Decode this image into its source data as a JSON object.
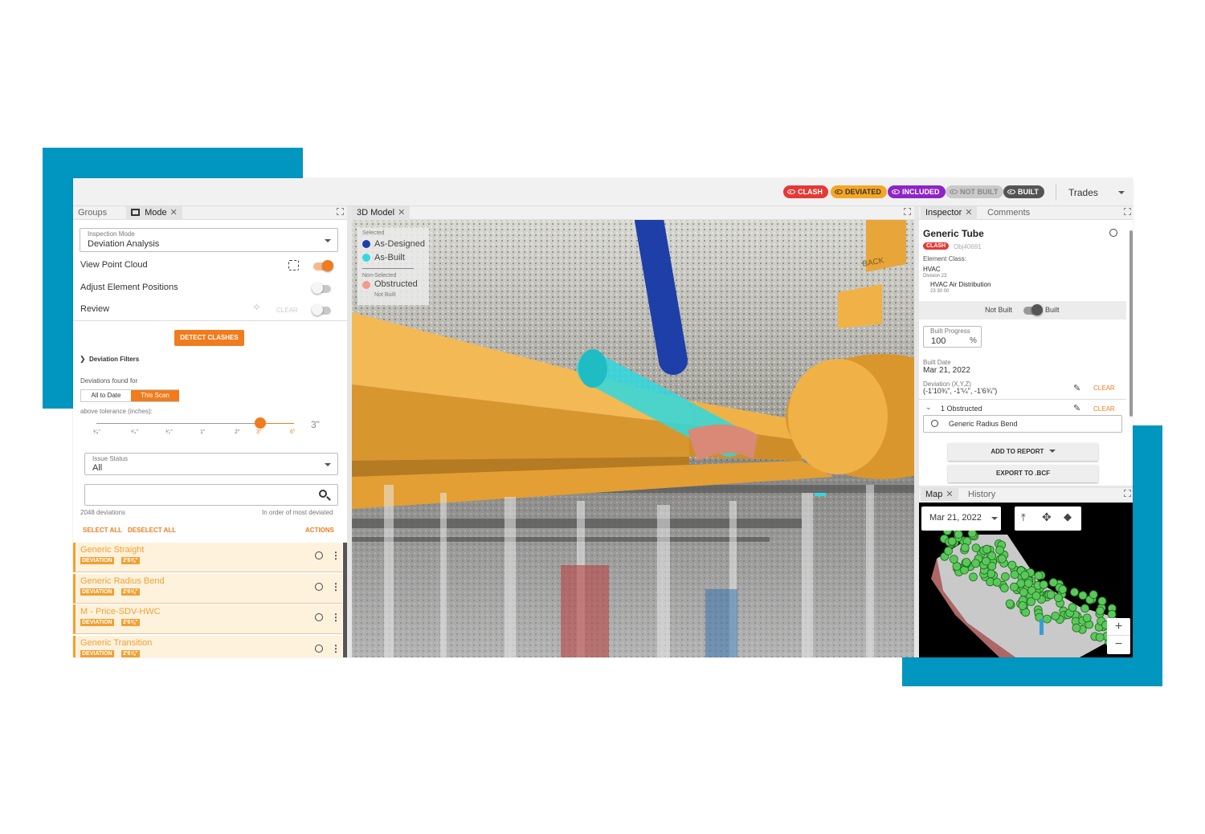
{
  "header": {
    "badges": [
      {
        "label": "CLASH",
        "color": "#e53935",
        "text_color": "#ffffff"
      },
      {
        "label": "DEVIATED",
        "color": "#f6a623",
        "text_color": "#333333"
      },
      {
        "label": "INCLUDED",
        "color": "#8e24c7",
        "text_color": "#ffffff"
      },
      {
        "label": "NOT BUILT",
        "color": "#c9c9c9",
        "text_color": "#888888"
      },
      {
        "label": "BUILT",
        "color": "#555555",
        "text_color": "#ffffff"
      }
    ],
    "trades_label": "Trades"
  },
  "left": {
    "tabs": [
      "Groups",
      "Mode"
    ],
    "inspection_mode_label": "Inspection Mode",
    "inspection_mode_value": "Deviation Analysis",
    "view_point_cloud": "View Point Cloud",
    "adjust_positions": "Adjust Element Positions",
    "review": "Review",
    "clear": "CLEAR",
    "detect_clashes": "DETECT CLASHES",
    "deviation_filters": "Deviation Filters",
    "deviations_found_for": "Deviations found for",
    "scope_options": [
      "All to Date",
      "This Scan"
    ],
    "scope_selected": "This Scan",
    "above_tolerance": "above tolerance (inches):",
    "slider_ticks": [
      "¹⁄₈\"",
      "¹⁄₄\"",
      "¹⁄₂\"",
      "1\"",
      "2\"",
      "3\"",
      "6\""
    ],
    "slider_value": "3\"",
    "issue_status_label": "Issue Status",
    "issue_status_value": "All",
    "search_placeholder": "",
    "count": "2048 deviations",
    "order": "In order of most deviated",
    "select_all": "SELECT ALL",
    "deselect_all": "DESELECT ALL",
    "actions": "ACTIONS",
    "items": [
      {
        "name": "Generic Straight",
        "tag": "DEVIATION",
        "value": "2'6⅝\""
      },
      {
        "name": "Generic Radius Bend",
        "tag": "DEVIATION",
        "value": "2'6⅝\""
      },
      {
        "name": "M - Price-SDV-HWC",
        "tag": "DEVIATION",
        "value": "2'6⅝\""
      },
      {
        "name": "Generic Transition",
        "tag": "DEVIATION",
        "value": "2'6⅝\""
      }
    ]
  },
  "viewer": {
    "tab": "3D Model",
    "legend": {
      "selected_title": "Selected",
      "as_designed": "As-Designed",
      "as_built": "As-Built",
      "non_selected_title": "Non-Selected",
      "obstructed": "Obstructed",
      "not_built": "Not Built"
    },
    "back_label": "BACK",
    "colors": {
      "as_designed": "#1e3fa8",
      "as_built": "#2fd9e0",
      "obstructed": "#f29a8c",
      "duct": "#e9a53a"
    }
  },
  "inspector": {
    "tabs": [
      "Inspector",
      "Comments"
    ],
    "title": "Generic Tube",
    "badge": "CLASH",
    "obj_id": "Obj40691",
    "element_class_label": "Element Class:",
    "element_class": "HVAC",
    "division_label": "Division 23",
    "division_value": "HVAC Air Distribution",
    "division_code": "23 30 00",
    "not_built": "Not Built",
    "built": "Built",
    "built_progress_label": "Built Progress",
    "built_progress_value": "100",
    "percent": "%",
    "built_date_label": "Built Date",
    "built_date_value": "Mar 21, 2022",
    "deviation_label": "Deviation (X,Y,Z)",
    "deviation_value": "(-1'10¾\", -1'¼\", -1'6¾\")",
    "clear": "CLEAR",
    "obstructed_count": "1 Obstructed",
    "obstructed_item": "Generic Radius Bend",
    "add_to_report": "ADD TO REPORT",
    "export_bcf": "EXPORT TO .BCF"
  },
  "map": {
    "tabs": [
      "Map",
      "History"
    ],
    "date": "Mar 21, 2022",
    "zoom_in": "+",
    "zoom_out": "−"
  }
}
